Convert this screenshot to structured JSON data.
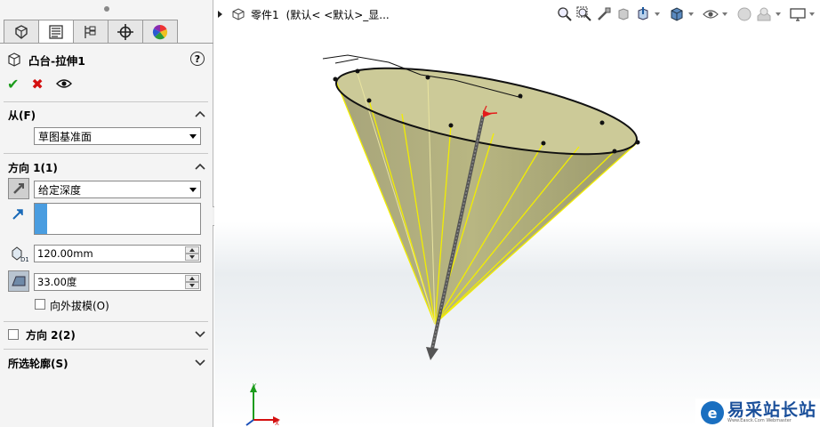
{
  "panel": {
    "tabs": [
      "feature-manager-icon",
      "property-manager-icon",
      "configuration-manager-icon",
      "dimxpert-icon",
      "display-manager-icon"
    ],
    "feature_title": "凸台-拉伸1",
    "help_label": "?",
    "from_section": {
      "label": "从(F)",
      "start_condition": "草图基准面"
    },
    "direction1": {
      "label": "方向 1(1)",
      "end_condition": "给定深度",
      "depth": "120.00mm",
      "draft_angle": "33.00度",
      "draft_outward_label": "向外拔模(O)"
    },
    "direction2": {
      "label": "方向 2(2)"
    },
    "selected_contours": {
      "label": "所选轮廓(S)"
    }
  },
  "viewport": {
    "part_name": "零件1",
    "config_text": "(默认< <默认>_显..."
  },
  "watermark": {
    "logo": "e",
    "text": "易采站长站",
    "subtext": "Www.Easck.Com Webmaster"
  },
  "colors": {
    "cone_fill": "#b8b682",
    "edge_yellow": "#f2ee00",
    "arrow_red": "#e41b1b",
    "ok_green": "#1c9c1c",
    "cancel_red": "#d41010"
  }
}
